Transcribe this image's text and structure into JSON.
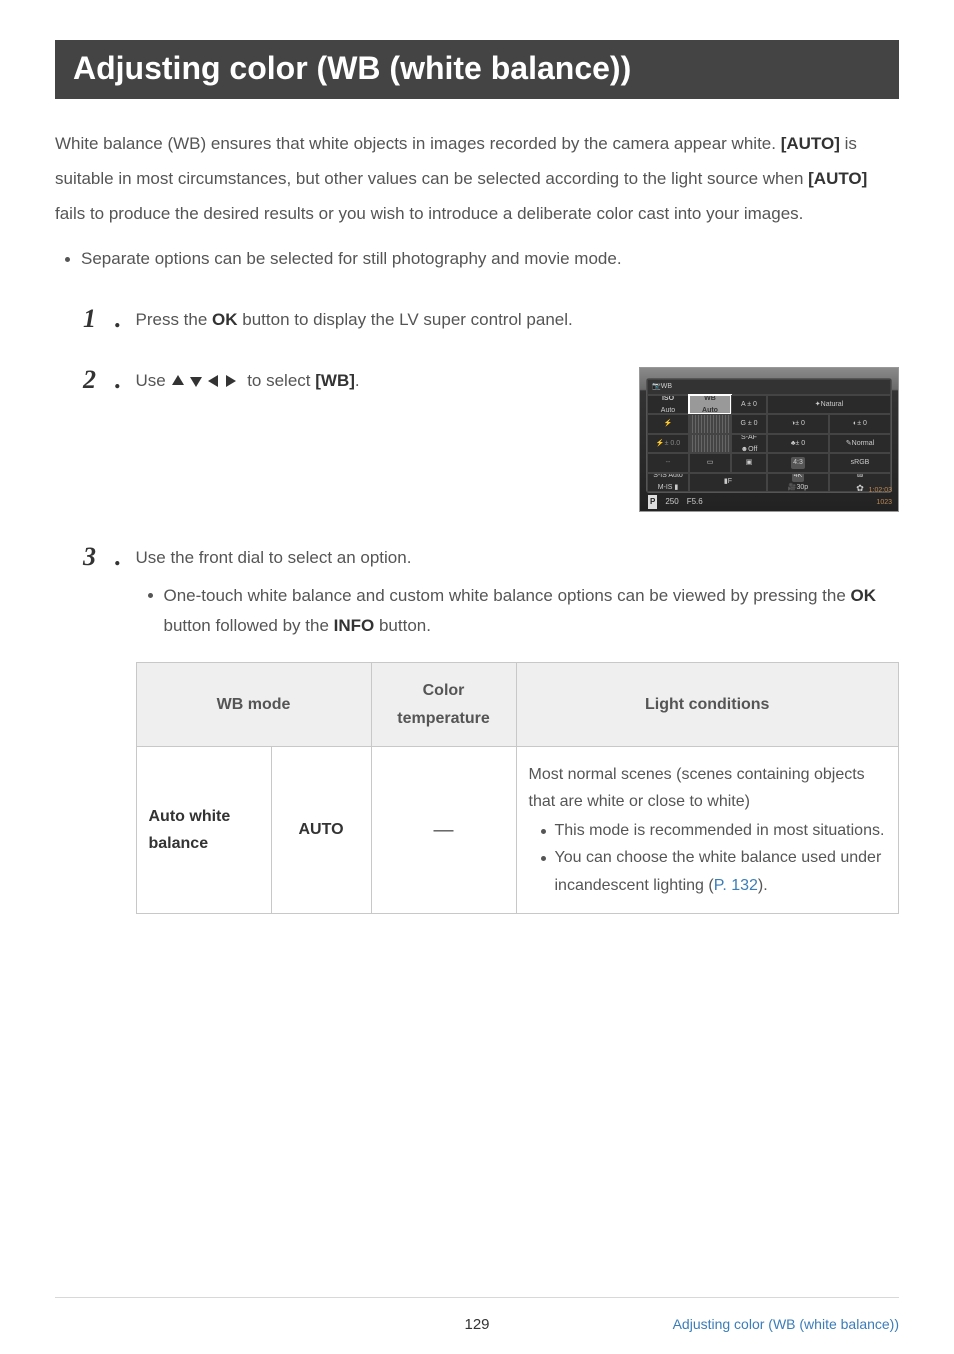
{
  "title": "Adjusting color (WB (white balance))",
  "intro": {
    "part1": "White balance (WB) ensures that white objects in images recorded by the camera appear white. ",
    "auto1": "[AUTO]",
    "part2": " is suitable in most circumstances, but other values can be selected according to the light source when ",
    "auto2": "[AUTO]",
    "part3": " fails to produce the desired results or you wish to introduce a deliberate color cast into your images."
  },
  "note_bullet": "Separate options can be selected for still photography and movie mode.",
  "step1": {
    "num": "1",
    "pre": "Press the ",
    "bold": "OK",
    "post": " button to display the LV super control panel."
  },
  "step2": {
    "num": "2",
    "pre": "Use ",
    "post_a": " to select ",
    "bold": "[WB]",
    "post_b": "."
  },
  "step3": {
    "num": "3",
    "text": "Use the front dial to select an option.",
    "sub_pre": "One-touch white balance and custom white balance options can be viewed by pressing the ",
    "sub_b1": "OK",
    "sub_mid": " button followed by the ",
    "sub_b2": "INFO",
    "sub_post": " button."
  },
  "lv": {
    "head": "WB",
    "iso_label": "ISO",
    "iso_val": "Auto",
    "wb_label": "WB",
    "wb_val": "Auto",
    "a0": "A ± 0",
    "g0": "G ± 0",
    "natural": "Natural",
    "s0a": "± 0",
    "s0b": "± 0",
    "saf": "S-AF",
    "off": "Off",
    "k0": "± 0",
    "normal": "Normal",
    "flash": "± 0.0",
    "ar": "4:3",
    "srgb": "sRGB",
    "sis": "S-IS Auto",
    "mis": "M-IS",
    "lf": "F",
    "fourk": "4K",
    "thirtyp": "30p",
    "p": "P",
    "shutter": "250",
    "fnum": "F5.6",
    "time": "1:02:03",
    "shots": "1023"
  },
  "table": {
    "h1": "WB mode",
    "h2a": "Color",
    "h2b": "temperature",
    "h3": "Light conditions",
    "r1": {
      "mode": "Auto white balance",
      "val": "AUTO",
      "temp": "―",
      "cond_main": "Most normal scenes (scenes containing objects that are white or close to white)",
      "bullet1": "This mode is recommended in most situations.",
      "bullet2a": "You can choose the white balance used under incandescent lighting (",
      "bullet2_link": "P. 132",
      "bullet2b": ")."
    }
  },
  "footer": {
    "page": "129",
    "crumb": "Adjusting color (WB (white balance))"
  }
}
